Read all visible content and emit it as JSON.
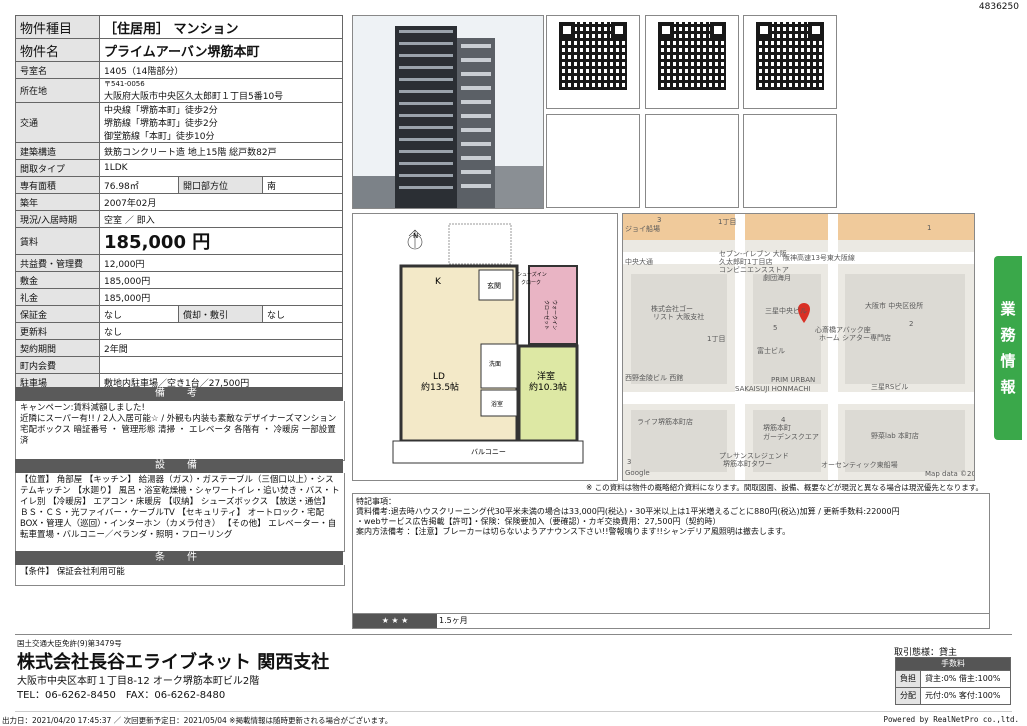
{
  "doc_id": "4836250",
  "spec": [
    {
      "label": "物件種目",
      "value": "［住居用］ マンション",
      "big": true
    },
    {
      "label": "物件名",
      "value": "プライムアーバン堺筋本町",
      "big": true
    },
    {
      "label": "号室名",
      "value": "1405（14階部分）"
    },
    {
      "label": "所在地",
      "value_small": "〒541-0056",
      "value": "大阪府大阪市中央区久太郎町１丁目5番10号"
    },
    {
      "label": "交通",
      "lines": [
        "中央線「堺筋本町」徒歩2分",
        "堺筋線「堺筋本町」徒歩2分",
        "御堂筋線「本町」徒歩10分"
      ]
    },
    {
      "label": "建築構造",
      "value": "鉄筋コンクリート造 地上15階 総戸数82戸"
    },
    {
      "label": "間取タイプ",
      "value": "1LDK"
    },
    {
      "label": "専有面積",
      "value": "76.98㎡",
      "label2": "開口部方位",
      "value2": "南"
    },
    {
      "label": "築年",
      "value": "2007年02月"
    },
    {
      "label": "現況/入居時期",
      "value": "空室 ／ 即入"
    },
    {
      "label": "賃料",
      "value": "185,000 円",
      "rent": true
    },
    {
      "label": "共益費・管理費",
      "value": "12,000円"
    },
    {
      "label": "敷金",
      "value": "185,000円"
    },
    {
      "label": "礼金",
      "value": "185,000円"
    },
    {
      "label": "保証金",
      "value": "なし",
      "label2": "償却・敷引",
      "value2": "なし"
    },
    {
      "label": "更新料",
      "value": "なし"
    },
    {
      "label": "契約期間",
      "value": "2年間"
    },
    {
      "label": "町内会費",
      "value": ""
    },
    {
      "label": "駐車場",
      "value": "敷地内駐車場／空き1台／27,500円"
    }
  ],
  "biko": {
    "heading": "備　考",
    "text": "キャンペーン:賃料減額しました!\n近隣にスーパー有!! / 2人入居可能☆ / 外観も内装も素敵なデザイナーズマンション\n宅配ボックス 暗証番号 ・ 管理形態 清掃 ・ エレベータ 各階有 ・ 冷暖房 一部設置済"
  },
  "setsubi": {
    "heading": "設　備",
    "text": "【位置】 角部屋 【キッチン】 給湯器（ガス）・ガステーブル（三個口以上）・システムキッチン 【水廻り】 風呂・浴室乾燥機・シャワートイレ・追い焚き・バス・トイレ別 【冷暖房】 エアコン・床暖房 【収納】 シューズボックス 【放送・通信】 ＢＳ・ＣＳ・光ファイバー・ケーブルTV 【セキュリティ】 オートロック・宅配BOX・管理人（巡回）・インターホン（カメラ付き） 【その他】 エレベーター・自転車置場・バルコニー／ベランダ・照明・フローリング"
  },
  "joken": {
    "heading": "条　件",
    "text": "【条件】 保証会社利用可能"
  },
  "floorplan": {
    "north": "N",
    "rooms": [
      {
        "name": "K",
        "sub": ""
      },
      {
        "name": "LD",
        "sub": "約13.5帖"
      },
      {
        "name": "洋室",
        "sub": "約10.3帖"
      },
      {
        "name": "玄関",
        "sub": ""
      },
      {
        "name": "シューズイン",
        "sub": "クローク"
      },
      {
        "name": "ウォークイン",
        "sub": "クローゼット"
      },
      {
        "name": "洗面",
        "sub": ""
      },
      {
        "name": "浴室",
        "sub": ""
      },
      {
        "name": "バルコニー",
        "sub": ""
      }
    ]
  },
  "map": {
    "labels": [
      {
        "text": "1丁目"
      },
      {
        "text": "ジョイ船場"
      },
      {
        "text": "セブン-イレブン 大阪"
      },
      {
        "text": "久太郎町1丁目店"
      },
      {
        "text": "コンビニエンスストア"
      },
      {
        "text": "阪神高速13号東大阪線"
      },
      {
        "text": "中央大通"
      },
      {
        "text": "劇団海月"
      },
      {
        "text": "株式会社ゴー"
      },
      {
        "text": "リスト 大阪支社"
      },
      {
        "text": "三星中央ビル"
      },
      {
        "text": "大阪市 中央区役所"
      },
      {
        "text": "心斎橋アバック座"
      },
      {
        "text": "ホーム シアター専門店"
      },
      {
        "text": "1丁目"
      },
      {
        "text": "富士ビル"
      },
      {
        "text": "西野金陵ビル 西館"
      },
      {
        "text": "PRIM URBAN"
      },
      {
        "text": "SAKAISUJI HONMACHI"
      },
      {
        "text": "三星RSビル"
      },
      {
        "text": "ライフ堺筋本町店"
      },
      {
        "text": "堺筋本町"
      },
      {
        "text": "ガーデンスクエア"
      },
      {
        "text": "野菜lab 本町店"
      },
      {
        "text": "プレサンスレジェンド"
      },
      {
        "text": "堺筋本町タワー"
      },
      {
        "text": "オーセンティック東船場"
      },
      {
        "text": "Google"
      },
      {
        "text": "Map data ©2020"
      },
      {
        "text": "3"
      },
      {
        "text": "1"
      },
      {
        "text": "2"
      },
      {
        "text": "5"
      },
      {
        "text": "4"
      },
      {
        "text": "3"
      }
    ]
  },
  "disclaimer": "※ この資料は物件の概略紹介資料になります。間取図面、設備、概要などが現況と異なる場合は現況優先となります。",
  "notes": {
    "title": "特記事項：",
    "lines": [
      "賃料備考:退去時ハウスクリーニング代30平米未満の場合は33,000円(税込)・30平米以上は1平米増えるごとに880円(税込)加算 / 更新手数料:22000円",
      "・webサービス広告掲載【許可】・保険：保険要加入（要確認）・カギ交換費用：27,500円（契約時）",
      "案内方法備考 ：【注意】ブレーカーは切らないようアナウンス下さい!!警報鳴ります!!シャンデリア風照明は撤去します。"
    ],
    "rating": "★ ★ ★",
    "period": "1.5ヶ月"
  },
  "sidetab": [
    "業",
    "務",
    "情",
    "報"
  ],
  "company": {
    "license": "国土交通大臣免許(9)第3479号",
    "name": "株式会社長谷エライブネット 関西支社",
    "address": "大阪市中央区本町１丁目8-12 オーク堺筋本町ビル2階",
    "phone": "TEL：06-6262-8450　FAX：06-6262-8480"
  },
  "trade": {
    "title": "取引態様：貸主",
    "fee_header": "手数料",
    "rows": [
      {
        "label": "負担",
        "value": "貸主:0% 借主:100%"
      },
      {
        "label": "分配",
        "value": "元付:0% 客付:100%"
      }
    ]
  },
  "bottom_left": "出力日：2021/04/20 17:45:37 ／ 次回更新予定日：2021/05/04 ※掲載情報は随時更新される場合がございます。",
  "bottom_right": "Powered by RealNetPro co.,ltd."
}
